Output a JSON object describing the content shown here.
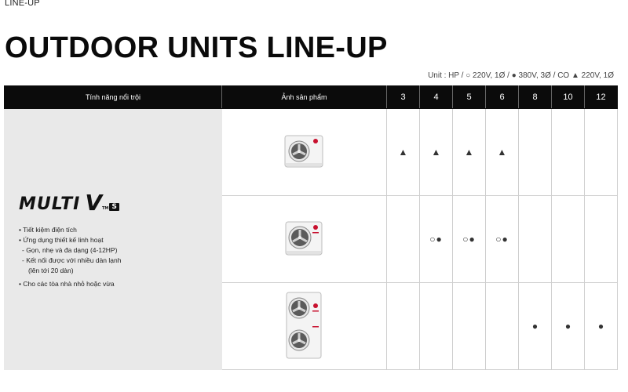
{
  "breadcrumb": "LINE-UP",
  "title": "OUTDOOR UNITS LINE-UP",
  "unit_note": "Unit : HP /  ○ 220V, 1Ø / ● 380V, 3Ø / CO ▲ 220V, 1Ø",
  "table": {
    "headers": {
      "features": "Tính năng nổi trội",
      "image": "Ảnh sản phẩm",
      "hp": [
        "3",
        "4",
        "5",
        "6",
        "8",
        "10",
        "12"
      ]
    },
    "product": {
      "logo_word": "MULTI",
      "logo_v": "V",
      "logo_tm": "TM",
      "logo_s": "S",
      "features": [
        "• Tiết kiệm điện tích",
        "• Ứng dụng thiết kế linh hoạt",
        "- Gọn, nhẹ và đa dạng (4-12HP)",
        "- Kết nối được với nhiều dàn lạnh",
        "(lên tới 20 dàn)",
        "• Cho các tòa nhà nhỏ hoặc vừa"
      ]
    },
    "rows": [
      {
        "image_icon": "outdoor-unit-single-fan-icon",
        "cells": [
          "▲",
          "▲",
          "▲",
          "▲",
          "",
          "",
          ""
        ]
      },
      {
        "image_icon": "outdoor-unit-single-fan-icon",
        "cells": [
          "",
          "○●",
          "○●",
          "○●",
          "",
          "",
          ""
        ]
      },
      {
        "image_icon": "outdoor-unit-double-fan-icon",
        "cells": [
          "",
          "",
          "",
          "",
          "●",
          "●",
          "●"
        ]
      }
    ]
  },
  "colors": {
    "header_bg": "#0b0b0b",
    "feature_bg": "#e9e9e9",
    "brand_red": "#c8102e"
  }
}
